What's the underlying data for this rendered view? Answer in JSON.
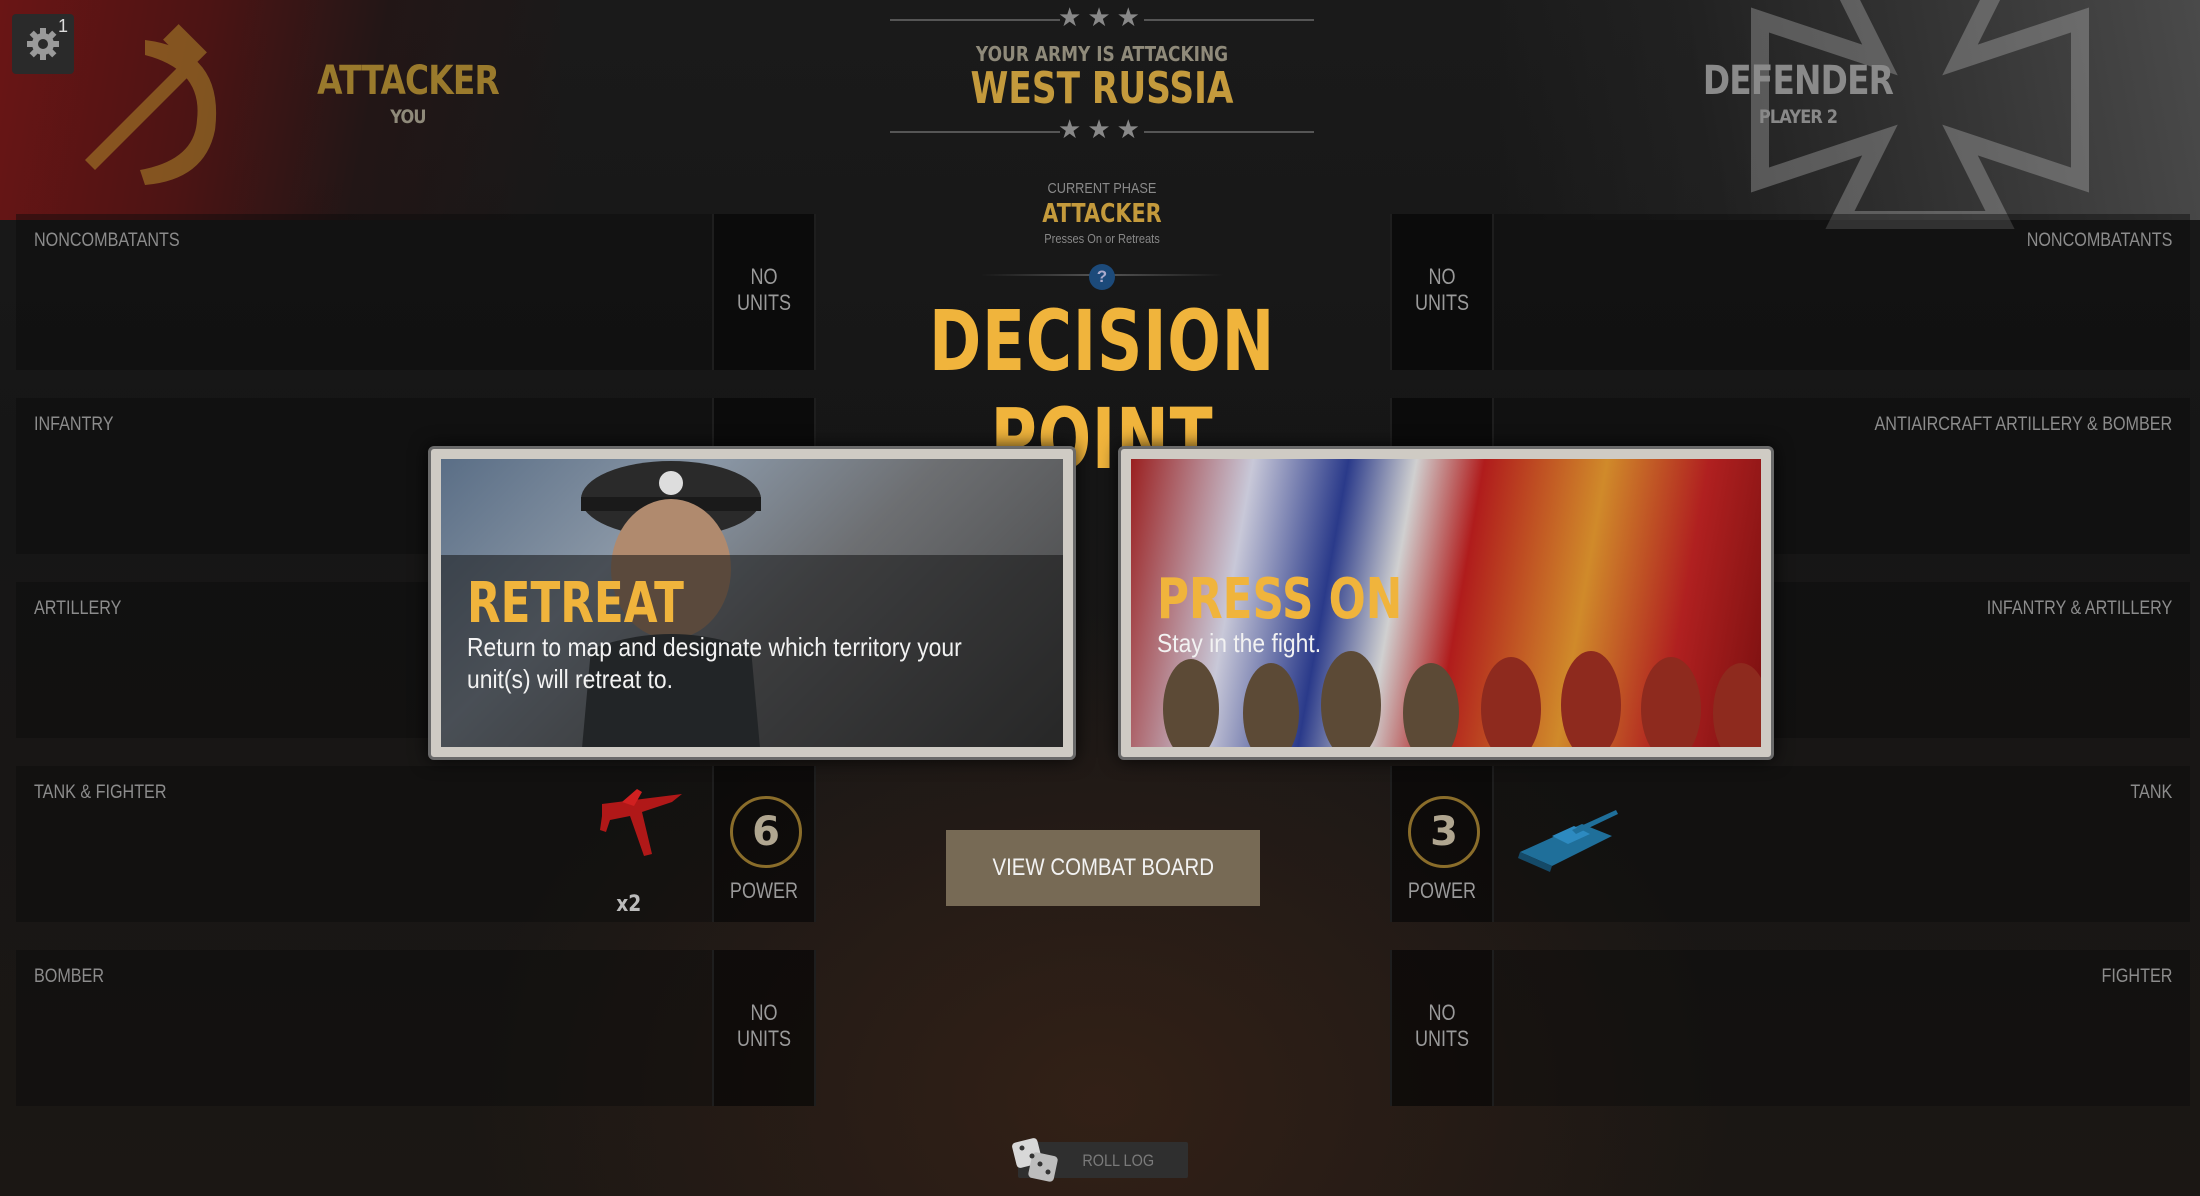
{
  "settings": {
    "notification_count": "1"
  },
  "attacker": {
    "title": "ATTACKER",
    "subtitle": "YOU"
  },
  "defender": {
    "title": "DEFENDER",
    "subtitle": "PLAYER 2"
  },
  "header": {
    "attacking_label": "YOUR ARMY IS ATTACKING",
    "territory": "WEST RUSSIA"
  },
  "phase": {
    "label": "CURRENT PHASE",
    "value": "ATTACKER",
    "subtitle": "Presses On or Retreats",
    "help": "?"
  },
  "decision_title": "DECISION POINT",
  "left_rows": [
    {
      "label": "NONCOMBATANTS",
      "status": "NO UNITS"
    },
    {
      "label": "INFANTRY"
    },
    {
      "label": "ARTILLERY"
    },
    {
      "label": "TANK & FIGHTER",
      "power": "6",
      "power_label": "POWER",
      "unit_count": "x2"
    },
    {
      "label": "BOMBER",
      "status": "NO UNITS"
    }
  ],
  "right_rows": [
    {
      "label": "NONCOMBATANTS",
      "status": "NO UNITS"
    },
    {
      "label": "ANTIAIRCRAFT ARTILLERY & BOMBER"
    },
    {
      "label": "INFANTRY & ARTILLERY"
    },
    {
      "label": "TANK",
      "power": "3",
      "power_label": "POWER"
    },
    {
      "label": "FIGHTER",
      "status": "NO UNITS"
    }
  ],
  "no_units_line1": "NO",
  "no_units_line2": "UNITS",
  "cards": {
    "retreat": {
      "title": "RETREAT",
      "description": "Return to map and designate which territory your unit(s) will retreat to."
    },
    "press_on": {
      "title": "PRESS ON",
      "description": "Stay in the fight."
    }
  },
  "view_combat_board_label": "VIEW COMBAT BOARD",
  "roll_log_label": "ROLL LOG",
  "colors": {
    "gold": "#f0b43c",
    "attacker_red": "#6a1515",
    "button": "#776a55"
  }
}
